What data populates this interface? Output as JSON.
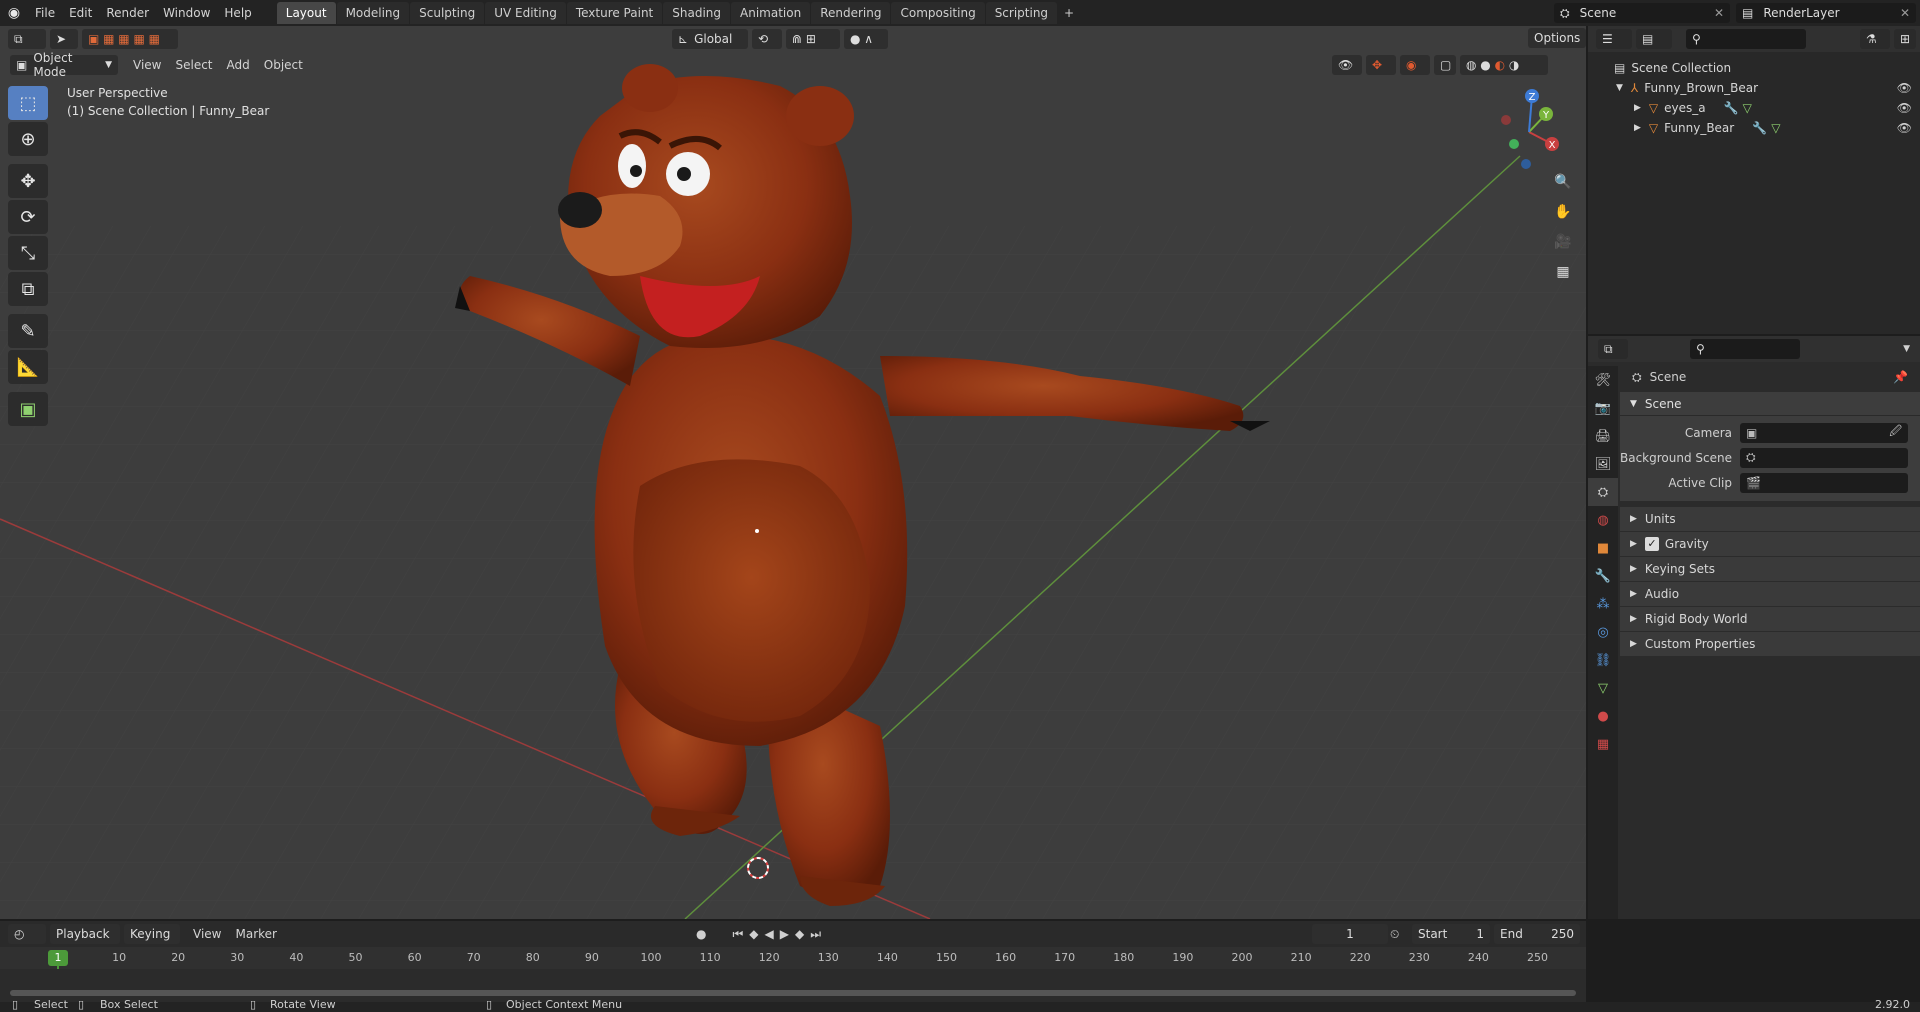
{
  "menu": [
    "File",
    "Edit",
    "Render",
    "Window",
    "Help"
  ],
  "workspace_tabs": [
    {
      "label": "Layout",
      "active": true
    },
    {
      "label": "Modeling"
    },
    {
      "label": "Sculpting"
    },
    {
      "label": "UV Editing"
    },
    {
      "label": "Texture Paint"
    },
    {
      "label": "Shading"
    },
    {
      "label": "Animation"
    },
    {
      "label": "Rendering"
    },
    {
      "label": "Compositing"
    },
    {
      "label": "Scripting"
    }
  ],
  "top_right": {
    "scene": "Scene",
    "render_layer": "RenderLayer"
  },
  "viewport": {
    "mode": "Object Mode",
    "menus": [
      "View",
      "Select",
      "Add",
      "Object"
    ],
    "transform_orientation": "Global",
    "options_label": "Options",
    "perspective_label": "User Perspective",
    "collection_label": "(1) Scene Collection | Funny_Bear",
    "gizmo_axes": {
      "x": "X",
      "y": "Y",
      "z": "Z"
    }
  },
  "outliner": {
    "root": "Scene Collection",
    "items": [
      {
        "label": "Funny_Brown_Bear",
        "indent": 1
      },
      {
        "label": "eyes_a",
        "indent": 2
      },
      {
        "label": "Funny_Bear",
        "indent": 2
      }
    ]
  },
  "properties": {
    "header": "Scene",
    "panel": "Scene",
    "rows": [
      {
        "label": "Camera"
      },
      {
        "label": "Background Scene"
      },
      {
        "label": "Active Clip"
      }
    ],
    "subpanels": [
      "Units",
      "Gravity",
      "Keying Sets",
      "Audio",
      "Rigid Body World",
      "Custom Properties"
    ],
    "gravity_checked": true
  },
  "timeline": {
    "menus": [
      "Playback",
      "Keying",
      "View",
      "Marker"
    ],
    "current_frame": "1",
    "start_label": "Start",
    "start": "1",
    "end_label": "End",
    "end": "250",
    "ruler": [
      "10",
      "20",
      "30",
      "40",
      "50",
      "60",
      "70",
      "80",
      "90",
      "100",
      "110",
      "120",
      "130",
      "140",
      "150",
      "160",
      "170",
      "180",
      "190",
      "200",
      "210",
      "220",
      "230",
      "240",
      "250"
    ],
    "playhead": "1"
  },
  "statusbar": {
    "select": "Select",
    "box_select": "Box Select",
    "rotate_view": "Rotate View",
    "context_menu": "Object Context Menu",
    "version": "2.92.0"
  },
  "colors": {
    "accent": "#5680c2",
    "x_axis": "#c84040",
    "y_axis": "#7ab53c",
    "z_axis": "#3d7bd6",
    "bear": "#8a2f12"
  }
}
